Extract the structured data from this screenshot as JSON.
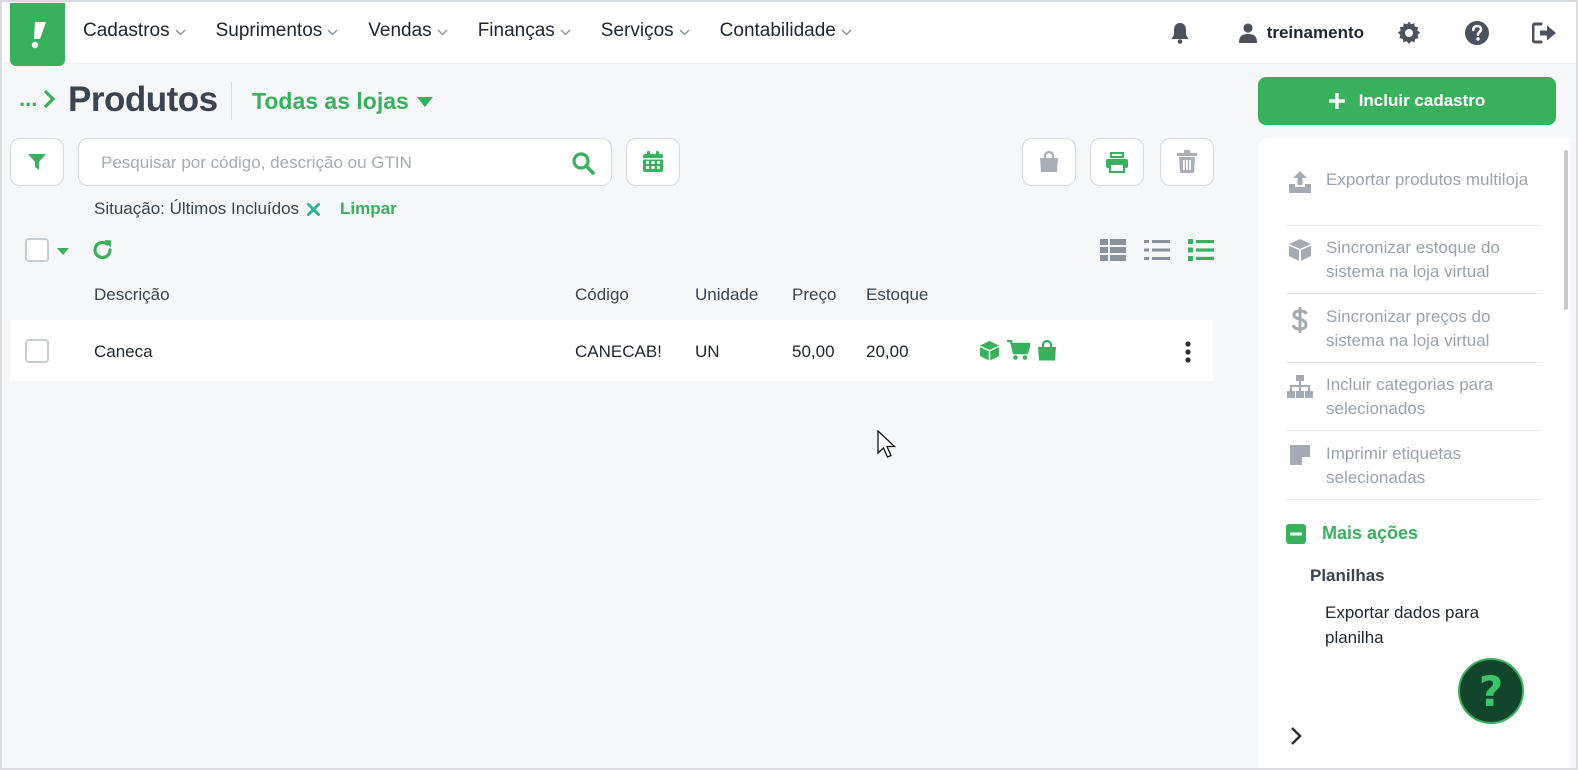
{
  "colors": {
    "accent": "#38b15c",
    "muted": "#9ba2ae",
    "text": "#1f2530"
  },
  "nav": {
    "items": [
      {
        "label": "Cadastros"
      },
      {
        "label": "Suprimentos"
      },
      {
        "label": "Vendas"
      },
      {
        "label": "Finanças"
      },
      {
        "label": "Serviços"
      },
      {
        "label": "Contabilidade"
      }
    ],
    "user": "treinamento",
    "icons": [
      "bell-icon",
      "user-icon",
      "gear-icon",
      "help-icon",
      "logout-icon"
    ]
  },
  "header": {
    "breadcrumb": "...",
    "title": "Produtos",
    "store": "Todas as lojas",
    "primary_button": "Incluir cadastro"
  },
  "toolbar": {
    "search_placeholder": "Pesquisar por código, descrição ou GTIN"
  },
  "filters": {
    "active": "Situação: Últimos Incluídos",
    "clear": "Limpar"
  },
  "table": {
    "columns": [
      "Descrição",
      "Código",
      "Unidade",
      "Preço",
      "Estoque"
    ],
    "rows": [
      {
        "descricao": "Caneca",
        "codigo": "CANECAB!",
        "unidade": "UN",
        "preco": "50,00",
        "estoque": "20,00"
      }
    ]
  },
  "side": {
    "items": [
      {
        "label": "Exportar produtos multiloja",
        "icon": "upload-icon"
      },
      {
        "label": "Sincronizar estoque do sistema na loja virtual",
        "icon": "box-icon"
      },
      {
        "label": "Sincronizar preços do sistema na loja virtual",
        "icon": "dollar-icon"
      },
      {
        "label": "Incluir categorias para selecionados",
        "icon": "sitemap-icon"
      },
      {
        "label": "Imprimir etiquetas selecionadas",
        "icon": "sticky-note-icon"
      }
    ],
    "more_actions": "Mais ações",
    "sheets_title": "Planilhas",
    "export_sheet": "Exportar dados para planilha"
  },
  "help_fab": "?"
}
